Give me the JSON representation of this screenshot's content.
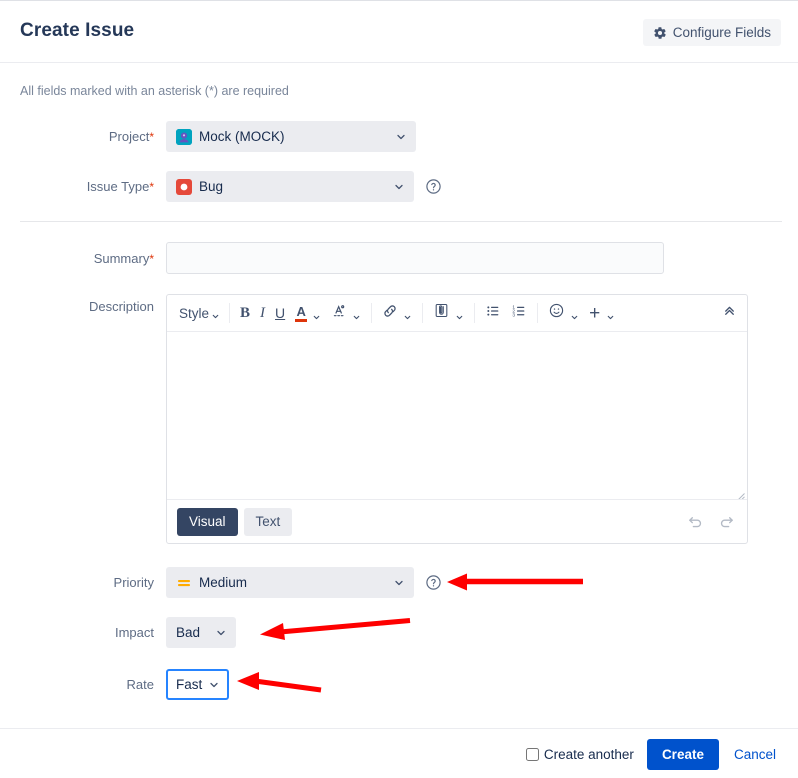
{
  "header": {
    "title": "Create Issue",
    "configure_label": "Configure Fields",
    "gear_icon": "gear-icon"
  },
  "body": {
    "required_note": "All fields marked with an asterisk (*) are required"
  },
  "fields": {
    "project": {
      "label": "Project",
      "required_marker": "*",
      "value": "Mock (MOCK)",
      "icon": "project-avatar-icon",
      "icon_color": "#00a3bf"
    },
    "issue_type": {
      "label": "Issue Type",
      "required_marker": "*",
      "value": "Bug",
      "icon": "bug-icon",
      "icon_color": "#e5493a",
      "help_icon": "help-circle-icon"
    },
    "summary": {
      "label": "Summary",
      "required_marker": "*",
      "value": "",
      "placeholder": ""
    },
    "description": {
      "label": "Description",
      "value": ""
    },
    "priority": {
      "label": "Priority",
      "value": "Medium",
      "icon": "priority-medium-icon",
      "icon_color": "#ffab00",
      "help_icon": "help-circle-icon"
    },
    "impact": {
      "label": "Impact",
      "value": "Bad"
    },
    "rate": {
      "label": "Rate",
      "value": "Fast",
      "focused": true,
      "focus_color": "#2684ff"
    }
  },
  "editor": {
    "toolbar": [
      {
        "name": "style-dropdown",
        "label": "Style",
        "has_chevron": true
      },
      {
        "name": "bold-icon",
        "label": "B"
      },
      {
        "name": "italic-icon",
        "label": "I"
      },
      {
        "name": "underline-icon",
        "label": "U"
      },
      {
        "name": "text-color-icon",
        "label": "A",
        "swatch": "#de350b",
        "has_chevron": true
      },
      {
        "name": "text-highlight-icon",
        "has_chevron": true
      },
      {
        "name": "link-icon",
        "has_chevron": true
      },
      {
        "name": "attachment-icon",
        "has_chevron": true
      },
      {
        "name": "bullet-list-icon"
      },
      {
        "name": "numbered-list-icon"
      },
      {
        "name": "emoji-icon",
        "has_chevron": true
      },
      {
        "name": "insert-more-icon",
        "label": "+",
        "has_chevron": true
      },
      {
        "name": "collapse-toolbar-icon"
      }
    ],
    "modes": [
      {
        "name": "visual-tab",
        "label": "Visual",
        "active": true
      },
      {
        "name": "text-tab",
        "label": "Text",
        "active": false
      }
    ],
    "undo_icon": "undo-icon",
    "redo_icon": "redo-icon",
    "content": ""
  },
  "footer": {
    "create_another_label": "Create another",
    "create_another_checked": false,
    "create_label": "Create",
    "cancel_label": "Cancel",
    "primary_color": "#0052cc"
  },
  "annotations": {
    "color": "#fe0000",
    "arrows": [
      {
        "name": "arrow-to-priority",
        "points_to": "priority-select"
      },
      {
        "name": "arrow-to-impact",
        "points_to": "impact-select"
      },
      {
        "name": "arrow-to-rate",
        "points_to": "rate-select"
      }
    ]
  }
}
